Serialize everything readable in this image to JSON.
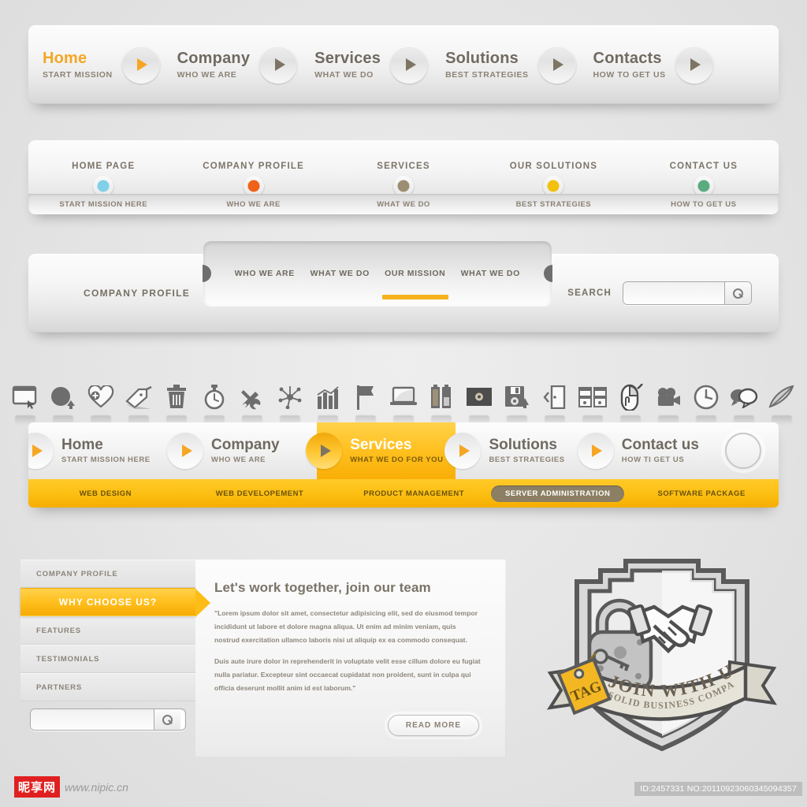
{
  "nav_primary": {
    "items": [
      {
        "title": "Home",
        "sub": "START MISSION",
        "active": true
      },
      {
        "title": "Company",
        "sub": "WHO WE ARE",
        "active": false
      },
      {
        "title": "Services",
        "sub": "WHAT WE DO",
        "active": false
      },
      {
        "title": "Solutions",
        "sub": "BEST STRATEGIES",
        "active": false
      },
      {
        "title": "Contacts",
        "sub": "HOW TO GET US",
        "active": false
      }
    ],
    "accent": "#f5a623"
  },
  "nav_dotted": {
    "items": [
      {
        "title": "HOME PAGE",
        "sub": "START MISSION HERE",
        "dot": "#7fd0e8"
      },
      {
        "title": "COMPANY PROFILE",
        "sub": "WHO WE ARE",
        "dot": "#ef6218"
      },
      {
        "title": "SERVICES",
        "sub": "WHAT WE DO",
        "dot": "#9b8e72"
      },
      {
        "title": "OUR SOLUTIONS",
        "sub": "BEST STRATEGIES",
        "dot": "#f2c10d"
      },
      {
        "title": "CONTACT US",
        "sub": "HOW TO GET US",
        "dot": "#5aac7e"
      }
    ]
  },
  "nav_search": {
    "brand": "COMPANY PROFILE",
    "subtabs": [
      {
        "label": "WHO WE ARE",
        "active": false
      },
      {
        "label": "WHAT WE DO",
        "active": false
      },
      {
        "label": "OUR MISSION",
        "active": true
      },
      {
        "label": "WHAT WE DO",
        "active": false
      }
    ],
    "search_label": "SEARCH",
    "search_value": "",
    "search_placeholder": "",
    "search_icon": "search-icon"
  },
  "icon_row": [
    "window-folder-icon",
    "pie-chart-upload-icon",
    "heart-plus-icon",
    "tag-icon",
    "trash-icon",
    "stopwatch-icon",
    "tools-icon",
    "network-icon",
    "bar-chart-icon",
    "flag-icon",
    "laptop-icon",
    "battery-icon",
    "film-reel-icon",
    "floppy-save-icon",
    "exit-door-icon",
    "windows-grid-icon",
    "mouse-click-icon",
    "video-camera-icon",
    "clock-icon",
    "speech-bubbles-icon",
    "feather-pen-icon"
  ],
  "nav_orange": {
    "items": [
      {
        "title": "Home",
        "sub": "START MISSION HERE",
        "active": false
      },
      {
        "title": "Company",
        "sub": "WHO WE ARE",
        "active": false
      },
      {
        "title": "Services",
        "sub": "WHAT WE DO FOR YOU",
        "active": true
      },
      {
        "title": "Solutions",
        "sub": "BEST STRATEGIES",
        "active": false
      },
      {
        "title": "Contact us",
        "sub": "HOW TI GET US",
        "active": false
      }
    ],
    "circle_button": "circle-button",
    "substrip": [
      {
        "label": "WEB DESIGN",
        "highlight": false
      },
      {
        "label": "WEB DEVELOPEMENT",
        "highlight": false
      },
      {
        "label": "PRODUCT MANAGEMENT",
        "highlight": false
      },
      {
        "label": "SERVER ADMINISTRATION",
        "highlight": true
      },
      {
        "label": "SOFTWARE PACKAGE",
        "highlight": false
      }
    ],
    "accent": "#fcbe12",
    "pill_color": "#8c7f63"
  },
  "panel": {
    "sidebar": [
      {
        "label": "COMPANY PROFILE",
        "active": false
      },
      {
        "label": "WHY CHOOSE US?",
        "active": true
      },
      {
        "label": "FEATURES",
        "active": false
      },
      {
        "label": "TESTIMONIALS",
        "active": false
      },
      {
        "label": "PARTNERS",
        "active": false
      }
    ],
    "sidebar_search_value": "",
    "sidebar_search_placeholder": "",
    "heading": "Let's work together, join our team",
    "paragraph1": "\"Lorem ipsum dolor sit amet, consectetur adipisicing elit, sed do eiusmod tempor incididunt ut labore et dolore magna aliqua. Ut enim ad minim veniam, quis nostrud exercitation ullamco laboris nisi ut aliquip ex ea commodo consequat.",
    "paragraph2": "Duis aute irure dolor in reprehenderit in voluptate velit esse cillum dolore eu fugiat nulla pariatur. Excepteur sint occaecat cupidatat non proident, sunt in culpa qui officia deserunt mollit anim id est laborum.\"",
    "read_more": "READ MORE"
  },
  "badge": {
    "ribbon_main": "JOIN WITH US",
    "ribbon_sub": "SOLID BUSINESS COMPANY",
    "tag_text": "TAG",
    "tag_color": "#f3b724",
    "icons": [
      "shield-icon",
      "padlock-icon",
      "handshake-icon",
      "price-tag-icon"
    ]
  },
  "footer": {
    "watermark_cn": "昵享网",
    "watermark_url": "www.nipic.cn",
    "id_text": "ID:2457331 NO:20110923060345094357"
  }
}
